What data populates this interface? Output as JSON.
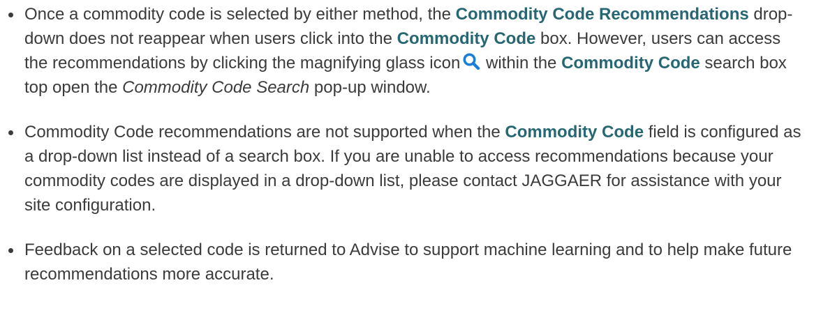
{
  "bullets": [
    {
      "segments": [
        {
          "text": "Once a commodity code is selected by either method, the ",
          "style": "normal"
        },
        {
          "text": "Commodity Code Recommendations",
          "style": "bold"
        },
        {
          "text": " drop-down does not reappear when users click into the ",
          "style": "normal"
        },
        {
          "text": "Commodity Code",
          "style": "bold"
        },
        {
          "text": " box. However, users can access the recommendations by clicking the magnifying glass icon",
          "style": "normal"
        },
        {
          "icon": "magnifying-glass-icon"
        },
        {
          "text": " within the ",
          "style": "normal"
        },
        {
          "text": "Commodity Code",
          "style": "bold"
        },
        {
          "text": " search box top open the ",
          "style": "normal"
        },
        {
          "text": "Commodity Code Search",
          "style": "italic"
        },
        {
          "text": " pop-up window.",
          "style": "normal"
        }
      ]
    },
    {
      "segments": [
        {
          "text": "Commodity Code recommendations are not supported when the ",
          "style": "normal"
        },
        {
          "text": "Commodity Code",
          "style": "bold"
        },
        {
          "text": " field is configured as a drop-down list instead of a search box. If you are unable to access recommendations because your commodity codes are displayed in a drop-down list, please contact JAGGAER for assistance with your site configuration.",
          "style": "normal"
        }
      ]
    },
    {
      "segments": [
        {
          "text": "Feedback on a selected code is returned to Advise to support machine learning and to help make future recommendations more accurate.",
          "style": "normal"
        }
      ]
    }
  ],
  "colors": {
    "text": "#3b3b3b",
    "bold_text": "#276773",
    "icon": "#1a7fd4"
  }
}
